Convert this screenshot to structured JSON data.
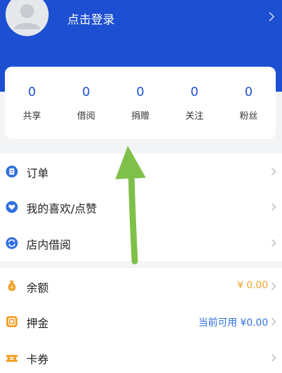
{
  "header": {
    "login_label": "点击登录",
    "bg_color": "#1c4fd1"
  },
  "stats": [
    {
      "value": "0",
      "label": "共享"
    },
    {
      "value": "0",
      "label": "借阅"
    },
    {
      "value": "0",
      "label": "捐赠"
    },
    {
      "value": "0",
      "label": "关注"
    },
    {
      "value": "0",
      "label": "粉丝"
    }
  ],
  "menu_primary": [
    {
      "label": "订单",
      "icon": "order-icon"
    },
    {
      "label": "我的喜欢/点赞",
      "icon": "heart-icon"
    },
    {
      "label": "店内借阅",
      "icon": "borrow-icon"
    }
  ],
  "menu_wallet": [
    {
      "label": "余额",
      "icon": "money-bag-icon",
      "value": "¥ 0.00"
    },
    {
      "label": "押金",
      "icon": "deposit-icon",
      "value": "当前可用 ¥0.00"
    },
    {
      "label": "卡券",
      "icon": "ticket-icon",
      "value": ""
    }
  ],
  "colors": {
    "accent_blue": "#1c4fd1",
    "orange": "#f2a22a",
    "arrow_green": "#7fc04a"
  }
}
